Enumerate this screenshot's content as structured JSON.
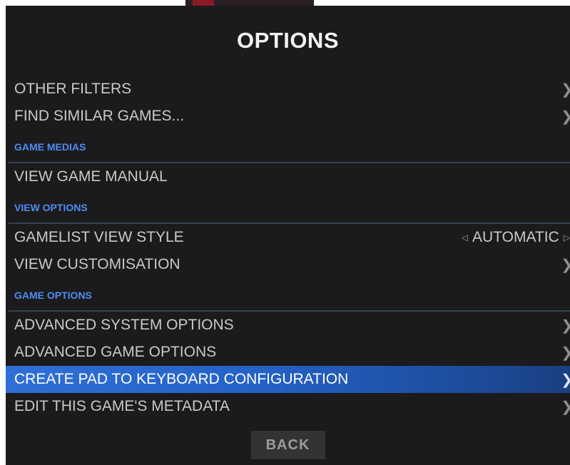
{
  "dialog": {
    "title": "OPTIONS",
    "back_label": "BACK"
  },
  "menu": {
    "other_filters": {
      "label": "OTHER FILTERS",
      "icon": "chevron-right-icon"
    },
    "find_similar": {
      "label": "FIND SIMILAR GAMES...",
      "icon": "chevron-right-icon"
    },
    "section_game_medias": "GAME MEDIAS",
    "view_manual": {
      "label": "VIEW GAME MANUAL"
    },
    "section_view_options": "VIEW OPTIONS",
    "gamelist_view_style": {
      "label": "GAMELIST VIEW STYLE",
      "value": "AUTOMATIC"
    },
    "view_customisation": {
      "label": "VIEW CUSTOMISATION",
      "icon": "chevron-right-icon"
    },
    "section_game_options": "GAME OPTIONS",
    "advanced_system_options": {
      "label": "ADVANCED SYSTEM OPTIONS",
      "icon": "chevron-right-icon"
    },
    "advanced_game_options": {
      "label": "ADVANCED GAME OPTIONS",
      "icon": "chevron-right-icon"
    },
    "create_pad_config": {
      "label": "CREATE PAD TO KEYBOARD CONFIGURATION",
      "icon": "chevron-right-icon",
      "selected": true
    },
    "edit_metadata": {
      "label": "EDIT THIS GAME'S METADATA",
      "icon": "chevron-right-icon"
    }
  },
  "colors": {
    "panel_bg": "#1b1b1d",
    "section_text": "#4f8df0",
    "selected_bg": "#2e6fd6",
    "text": "#c9c9c9"
  }
}
